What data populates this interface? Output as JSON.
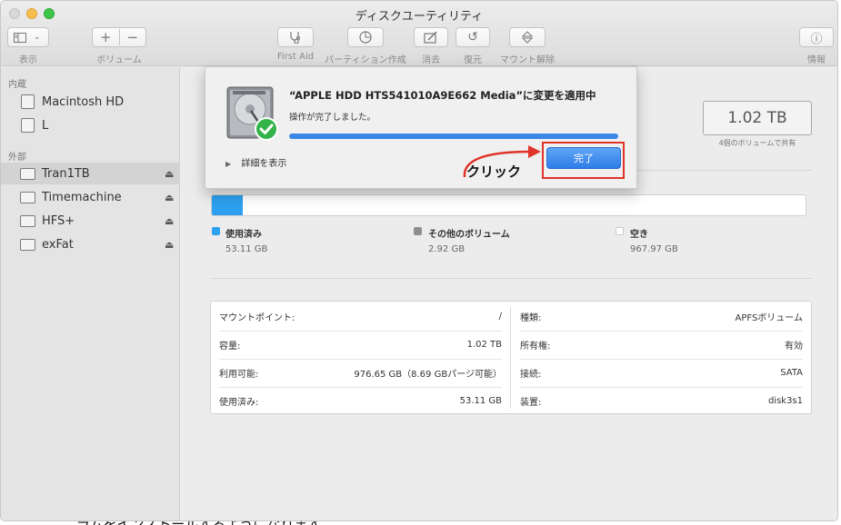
{
  "window": {
    "title": "ディスクユーティリティ"
  },
  "toolbar": {
    "view_label": "表示",
    "volume_label": "ボリューム",
    "first_aid_label": "First Aid",
    "partition_label": "パーティション作成",
    "erase_label": "消去",
    "restore_label": "復元",
    "unmount_label": "マウント解除",
    "info_label": "情報",
    "add_symbol": "+",
    "remove_symbol": "−"
  },
  "sidebar": {
    "internal_title": "内蔵",
    "external_title": "外部",
    "internal_items": [
      {
        "label": "Macintosh HD"
      },
      {
        "label": "L"
      }
    ],
    "external_items": [
      {
        "label": "Tran1TB",
        "eject": "⏏",
        "selected": true
      },
      {
        "label": "Timemachine",
        "eject": "⏏"
      },
      {
        "label": "HFS+",
        "eject": "⏏"
      },
      {
        "label": "exFat",
        "eject": "⏏"
      }
    ]
  },
  "capacity": {
    "value": "1.02 TB",
    "sub": "4個のボリュームで共有"
  },
  "usage": {
    "used_fraction": 0.052,
    "legend": [
      {
        "name": "使用済み",
        "value": "53.11 GB",
        "color": "#2ea0f0"
      },
      {
        "name": "その他のボリューム",
        "value": "2.92 GB",
        "color": "#8e8e8e"
      },
      {
        "name": "空き",
        "value": "967.97 GB",
        "color": "#ffffff"
      }
    ]
  },
  "info": {
    "left": [
      {
        "key": "マウントポイント:",
        "value": "/"
      },
      {
        "key": "容量:",
        "value": "1.02 TB"
      },
      {
        "key": "利用可能:",
        "value": "976.65 GB（8.69 GBパージ可能）"
      },
      {
        "key": "使用済み:",
        "value": "53.11 GB"
      }
    ],
    "right": [
      {
        "key": "種類:",
        "value": "APFSボリューム"
      },
      {
        "key": "所有権:",
        "value": "有効"
      },
      {
        "key": "接続:",
        "value": "SATA"
      },
      {
        "key": "装置:",
        "value": "disk3s1"
      }
    ]
  },
  "sheet": {
    "title": "“APPLE HDD HTS541010A9E662 Media”に変更を適用中",
    "status": "操作が完了しました。",
    "progress": 1.0,
    "details_label": "詳細を表示",
    "done_label": "完了"
  },
  "annotation": {
    "click_label": "クリック",
    "accent": "#e0342a"
  },
  "background": {
    "partial_text": "ラムをインストールするようになります"
  },
  "colors": {
    "accent": "#3b87e8",
    "used": "#2ea0f0"
  }
}
